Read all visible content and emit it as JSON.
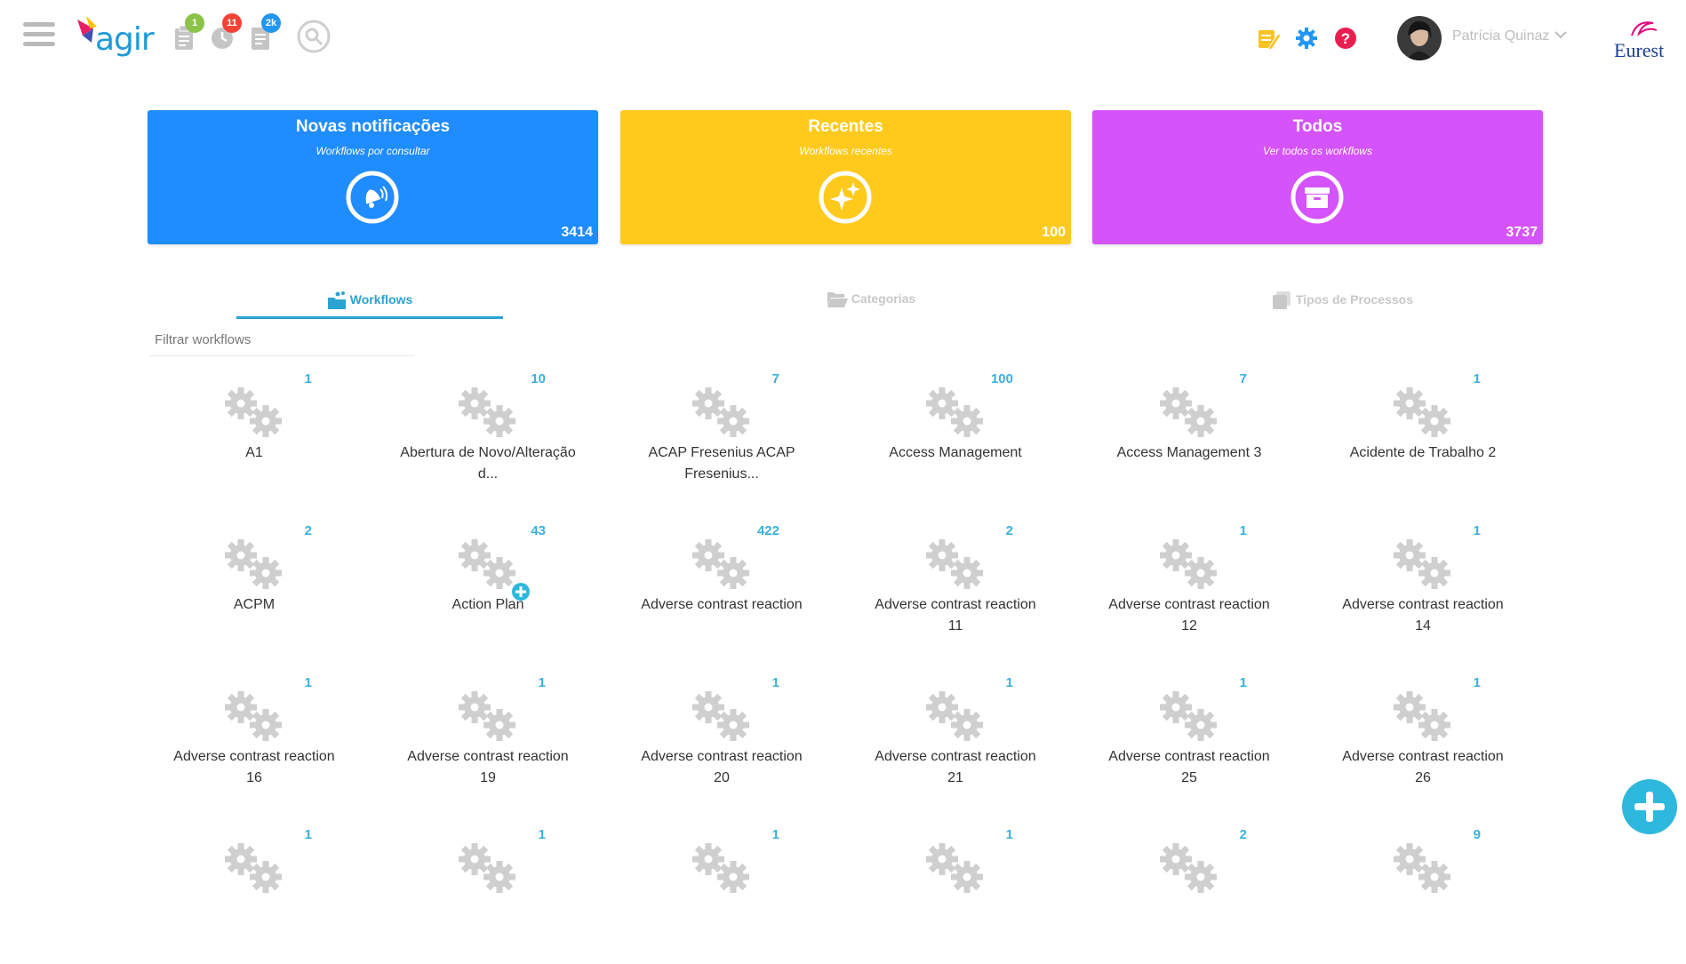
{
  "header": {
    "logo_text": "agir",
    "badges": [
      {
        "icon": "clipboard-icon",
        "count": "1",
        "color": "#8bc34a"
      },
      {
        "icon": "clock-icon",
        "count": "11",
        "color": "#f44336"
      },
      {
        "icon": "document-icon",
        "count": "2k",
        "color": "#2196f3"
      }
    ],
    "user_name": "Patrícia Quinaz",
    "brand": "Eurest"
  },
  "cards": [
    {
      "title": "Novas notificações",
      "subtitle": "Workflows por consultar",
      "count": "3414",
      "color": "#1f8cff",
      "icon": "bell-icon"
    },
    {
      "title": "Recentes",
      "subtitle": "Workflows recentes",
      "count": "100",
      "color": "#ffca1c",
      "icon": "sparkle-icon"
    },
    {
      "title": "Todos",
      "subtitle": "Ver todos os workflows",
      "count": "3737",
      "color": "#d553fb",
      "icon": "archive-icon"
    }
  ],
  "tabs": [
    {
      "label": "Workflows",
      "active": true
    },
    {
      "label": "Categorias",
      "active": false
    },
    {
      "label": "Tipos de Processos",
      "active": false
    }
  ],
  "filter": {
    "placeholder": "Filtrar workflows"
  },
  "workflows": [
    {
      "name": "A1",
      "count": "1"
    },
    {
      "name": "Abertura de Novo/Alteração d...",
      "count": "10"
    },
    {
      "name": "ACAP Fresenius ACAP Fresenius...",
      "count": "7"
    },
    {
      "name": "Access Management",
      "count": "100"
    },
    {
      "name": "Access Management 3",
      "count": "7"
    },
    {
      "name": "Acidente de Trabalho 2",
      "count": "1"
    },
    {
      "name": "ACPM",
      "count": "2"
    },
    {
      "name": "Action Plan",
      "count": "43"
    },
    {
      "name": "Adverse contrast reaction",
      "count": "422"
    },
    {
      "name": "Adverse contrast reaction 11",
      "count": "2"
    },
    {
      "name": "Adverse contrast reaction 12",
      "count": "1"
    },
    {
      "name": "Adverse contrast reaction 14",
      "count": "1"
    },
    {
      "name": "Adverse contrast reaction 16",
      "count": "1"
    },
    {
      "name": "Adverse contrast reaction 19",
      "count": "1"
    },
    {
      "name": "Adverse contrast reaction 20",
      "count": "1"
    },
    {
      "name": "Adverse contrast reaction 21",
      "count": "1"
    },
    {
      "name": "Adverse contrast reaction 25",
      "count": "1"
    },
    {
      "name": "Adverse contrast reaction 26",
      "count": "1"
    },
    {
      "name": "",
      "count": "1"
    },
    {
      "name": "",
      "count": "1"
    },
    {
      "name": "",
      "count": "1"
    },
    {
      "name": "",
      "count": "1"
    },
    {
      "name": "",
      "count": "2"
    },
    {
      "name": "",
      "count": "9"
    }
  ]
}
